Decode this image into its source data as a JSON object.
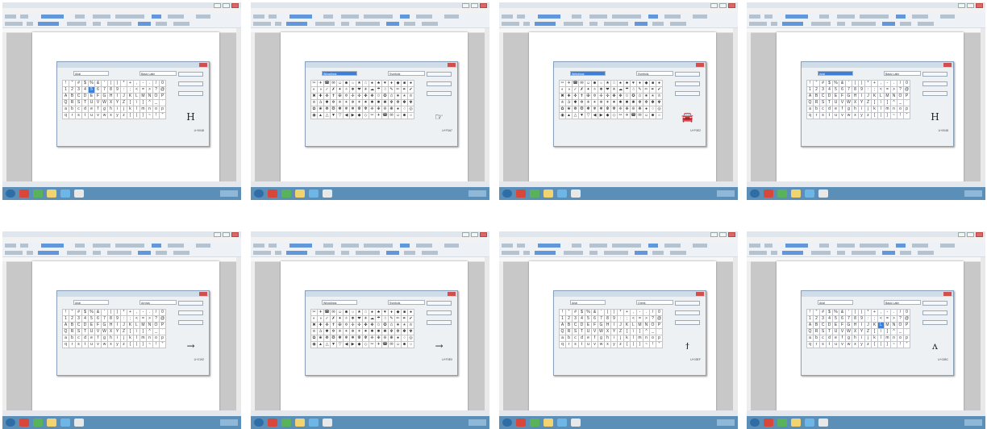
{
  "thumbnails": [
    {
      "font_label": "Arial",
      "subset": "Basic Latin",
      "preview_glyph": "H",
      "code": "U+0048",
      "highlight": 20,
      "dense": false
    },
    {
      "font_label": "Wingdings",
      "subset": "Symbols",
      "preview_glyph": "☞",
      "code": "U+F0A7",
      "highlight": -1,
      "dense": true
    },
    {
      "font_label": "Webdings",
      "subset": "Symbols",
      "preview_glyph": "🚘",
      "code": "U+F0E2",
      "highlight": -1,
      "dense": true
    },
    {
      "font_label": "Arial",
      "subset": "Basic Latin",
      "preview_glyph": "H",
      "code": "U+0048",
      "highlight": -1,
      "dense": false
    },
    {
      "font_label": "Arial",
      "subset": "Arrows",
      "preview_glyph": "→",
      "code": "U+2192",
      "highlight": -1,
      "dense": false
    },
    {
      "font_label": "Wingdings",
      "subset": "Symbols",
      "preview_glyph": "→",
      "code": "U+F0E0",
      "highlight": -1,
      "dense": true
    },
    {
      "font_label": "Arial",
      "subset": "Greek",
      "preview_glyph": "ϯ",
      "code": "U+03EF",
      "highlight": -1,
      "dense": false
    },
    {
      "font_label": "Arial",
      "subset": "Basic Latin",
      "preview_glyph": "ʌ",
      "code": "U+028C",
      "highlight": 43,
      "dense": false
    }
  ],
  "glyphs": "!\"#$%&'()*+,-./0123456789:;<=>?@ABCDEFGHIJKLMNOPQRSTUVWXYZ[\\]^_`abcdefghijklmnopqrstuvwxyz{|}~",
  "dense_glyphs": "✂✈☎✉☺☻☼★☆♠♣♥♦◆■●◐◑✓✗✦✧❖❤☀☁☂☃✎✏✒✔✖✚✜✝✠✡✢✣✤✥✩✪✫✬✭✮✯✰✱✲✳✴✵✶✷✸✹✺✻✼✽✾✿❀❁❂❃❄❅❆❇❈❉❊❋●○◎◉▲△▼▽◀▶◆◇",
  "colors": {
    "accent": "#3c7fd8",
    "taskbar": "#5b8fb8",
    "dialog_bg": "#eef1f4"
  }
}
